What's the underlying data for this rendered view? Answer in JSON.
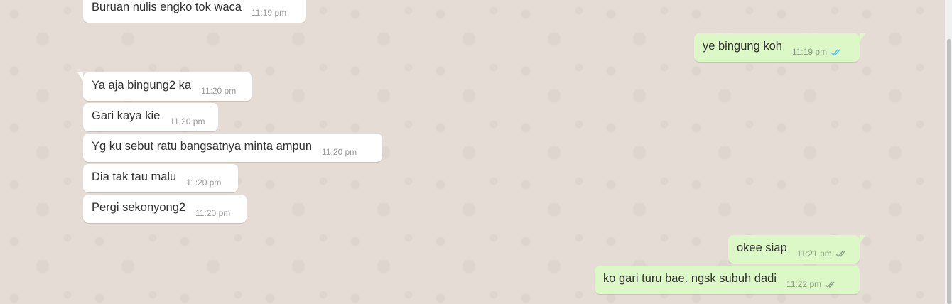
{
  "messages": [
    {
      "id": "m1",
      "direction": "in",
      "text": "Buruan nulis engko tok waca",
      "time": "11:19 pm"
    },
    {
      "id": "m2",
      "direction": "out",
      "text": "ye bingung koh",
      "time": "11:19 pm",
      "status": "read"
    },
    {
      "id": "m3",
      "direction": "in",
      "text": "Ya aja bingung2 ka",
      "time": "11:20 pm"
    },
    {
      "id": "m4",
      "direction": "in",
      "text": "Gari kaya kie",
      "time": "11:20 pm"
    },
    {
      "id": "m5",
      "direction": "in",
      "text": "Yg ku sebut ratu bangsatnya minta ampun",
      "time": "11:20 pm"
    },
    {
      "id": "m6",
      "direction": "in",
      "text": "Dia tak tau malu",
      "time": "11:20 pm"
    },
    {
      "id": "m7",
      "direction": "in",
      "text": "Pergi sekonyong2",
      "time": "11:20 pm"
    },
    {
      "id": "m8",
      "direction": "out",
      "text": "okee siap",
      "time": "11:21 pm",
      "status": "delivered"
    },
    {
      "id": "m9",
      "direction": "out",
      "text": "ko gari turu bae. ngsk subuh dadi",
      "time": "11:22 pm",
      "status": "delivered"
    }
  ],
  "colors": {
    "wallpaper": "#e5ddd5",
    "incoming_bubble": "#ffffff",
    "outgoing_bubble": "#dcf8c6",
    "read_tick": "#4fc3f7",
    "delivered_tick": "#92a58c"
  }
}
